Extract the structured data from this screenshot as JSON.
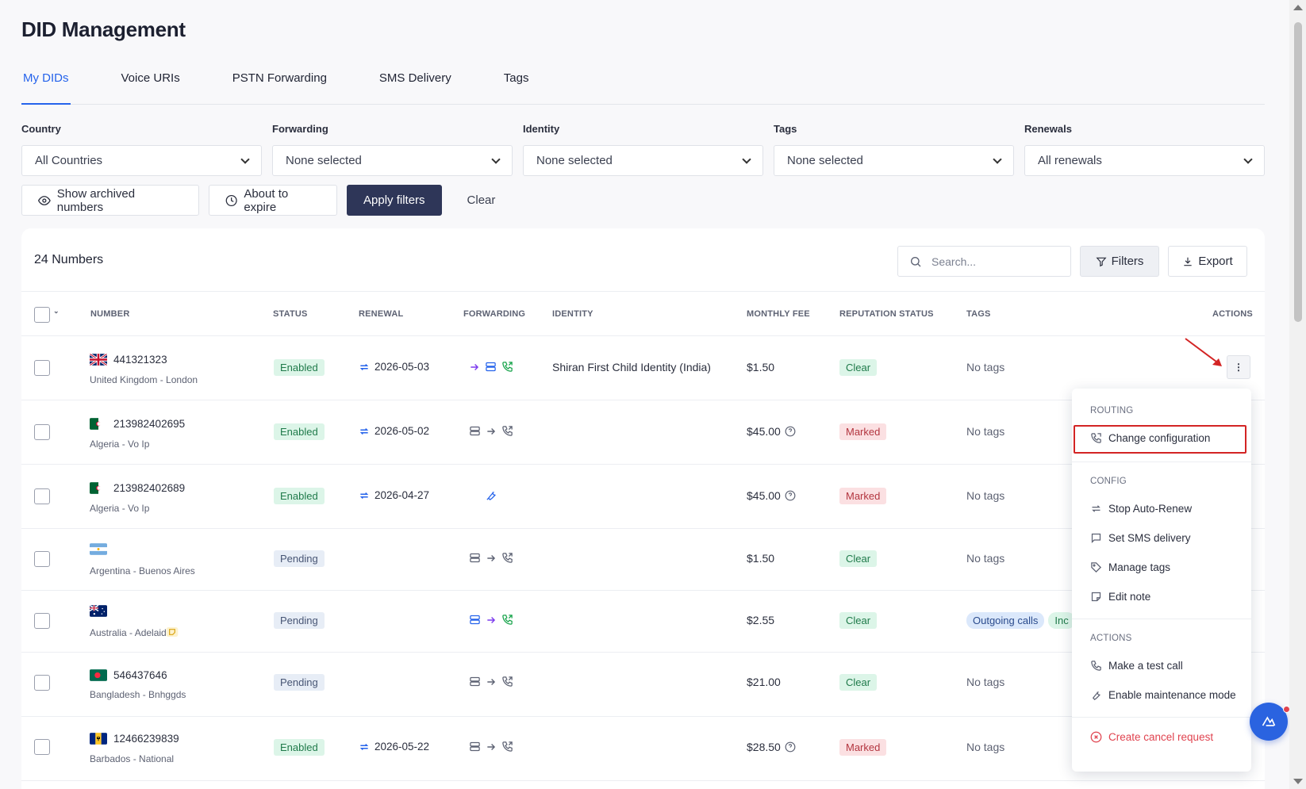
{
  "page_title": "DID Management",
  "tabs": [
    {
      "label": "My DIDs",
      "active": true
    },
    {
      "label": "Voice URIs"
    },
    {
      "label": "PSTN Forwarding"
    },
    {
      "label": "SMS Delivery"
    },
    {
      "label": "Tags"
    }
  ],
  "filters": {
    "country_label": "Country",
    "country_value": "All Countries",
    "forwarding_label": "Forwarding",
    "forwarding_value": "None selected",
    "identity_label": "Identity",
    "identity_value": "None selected",
    "tags_label": "Tags",
    "tags_value": "None selected",
    "renewals_label": "Renewals",
    "renewals_value": "All renewals"
  },
  "actions_row": {
    "show_archived": "Show archived numbers",
    "about_to_expire": "About to expire",
    "apply_filters": "Apply filters",
    "clear": "Clear"
  },
  "table_header": {
    "count": "24 Numbers",
    "search_placeholder": "Search...",
    "filters_label": "Filters",
    "export_label": "Export",
    "columns": {
      "number": "NUMBER",
      "status": "STATUS",
      "renewal": "RENEWAL",
      "forwarding": "FORWARDING",
      "identity": "IDENTITY",
      "monthly_fee": "MONTHLY FEE",
      "reputation": "REPUTATION STATUS",
      "tags": "TAGS",
      "actions": "ACTIONS"
    }
  },
  "rows": [
    {
      "number": "441321323",
      "location": "United Kingdom - London",
      "status": "Enabled",
      "renewal": "2026-05-03",
      "identity": "Shiran First Child Identity (India)",
      "fee": "$1.50",
      "reputation": "Clear",
      "tags": "No tags"
    },
    {
      "number": "213982402695",
      "location": "Algeria - Vo Ip",
      "status": "Enabled",
      "renewal": "2026-05-02",
      "identity": "",
      "fee": "$45.00",
      "reputation": "Marked",
      "tags": "No tags"
    },
    {
      "number": "213982402689",
      "location": "Algeria - Vo Ip",
      "status": "Enabled",
      "renewal": "2026-04-27",
      "identity": "",
      "fee": "$45.00",
      "reputation": "Marked",
      "tags": "No tags"
    },
    {
      "number": "",
      "location": "Argentina - Buenos Aires",
      "status": "Pending",
      "renewal": "",
      "identity": "",
      "fee": "$1.50",
      "reputation": "Clear",
      "tags": "No tags"
    },
    {
      "number": "",
      "location": "Australia - Adelaide",
      "status": "Pending",
      "renewal": "",
      "identity": "",
      "fee": "$2.55",
      "reputation": "Clear",
      "tag_pills": [
        "Outgoing calls",
        "Inc"
      ]
    },
    {
      "number": "546437646",
      "location": "Bangladesh - Bnhggds",
      "status": "Pending",
      "renewal": "",
      "identity": "",
      "fee": "$21.00",
      "reputation": "Clear",
      "tags": "No tags"
    },
    {
      "number": "12466239839",
      "location": "Barbados - National",
      "status": "Enabled",
      "renewal": "2026-05-22",
      "identity": "",
      "fee": "$28.50",
      "reputation": "Marked",
      "tags": "No tags"
    }
  ],
  "context_menu": {
    "routing_header": "ROUTING",
    "change_configuration": "Change configuration",
    "config_header": "CONFIG",
    "stop_auto_renew": "Stop Auto-Renew",
    "set_sms_delivery": "Set SMS delivery",
    "manage_tags": "Manage tags",
    "edit_note": "Edit note",
    "actions_header": "ACTIONS",
    "make_test_call": "Make a test call",
    "enable_maintenance": "Enable maintenance mode",
    "create_cancel": "Create cancel request"
  },
  "colors": {
    "accent": "#2563eb",
    "primary_button": "#2e3658",
    "annotation_red": "#d32424"
  }
}
